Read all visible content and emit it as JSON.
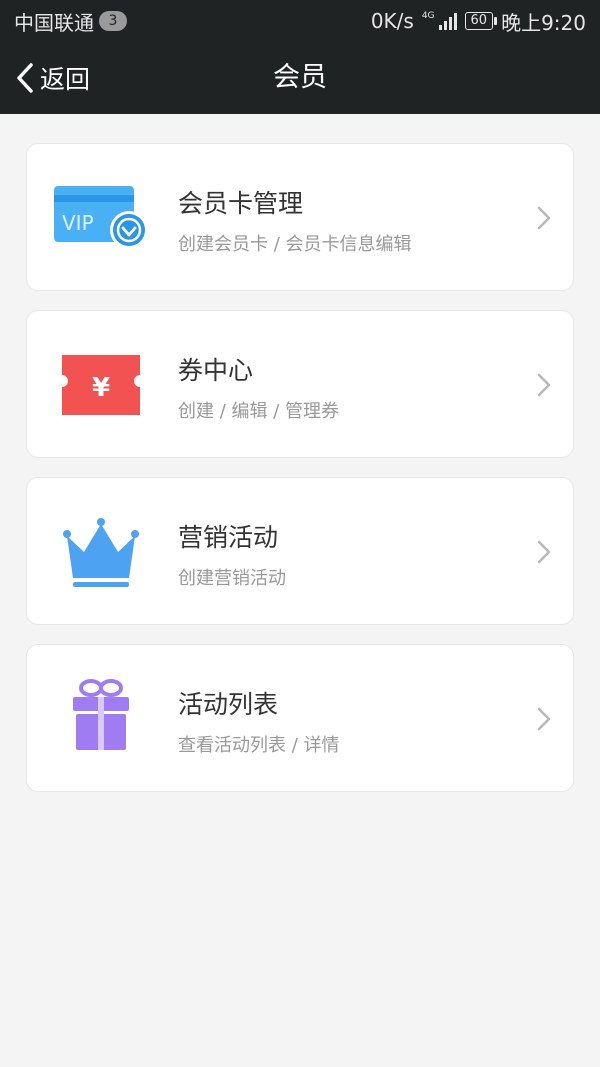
{
  "status_bar": {
    "carrier": "中国联通",
    "notification_count": "3",
    "speed": "0K/s",
    "network": "4G",
    "battery": "60",
    "time": "晚上9:20"
  },
  "nav": {
    "back_label": "返回",
    "title": "会员"
  },
  "menu": [
    {
      "icon": "vip-card-icon",
      "title": "会员卡管理",
      "subtitle": "创建会员卡 / 会员卡信息编辑",
      "icon_text": "VIP",
      "color": "#4ab0f5"
    },
    {
      "icon": "coupon-icon",
      "title": "券中心",
      "subtitle": "创建 / 编辑 / 管理券",
      "icon_text": "¥",
      "color": "#f25252"
    },
    {
      "icon": "crown-icon",
      "title": "营销活动",
      "subtitle": "创建营销活动",
      "color": "#4da3f2"
    },
    {
      "icon": "gift-icon",
      "title": "活动列表",
      "subtitle": "查看活动列表 / 详情",
      "color": "#a07cf2"
    }
  ],
  "colors": {
    "header_bg": "#1f2324",
    "page_bg": "#f4f4f4",
    "card_bg": "#ffffff"
  }
}
